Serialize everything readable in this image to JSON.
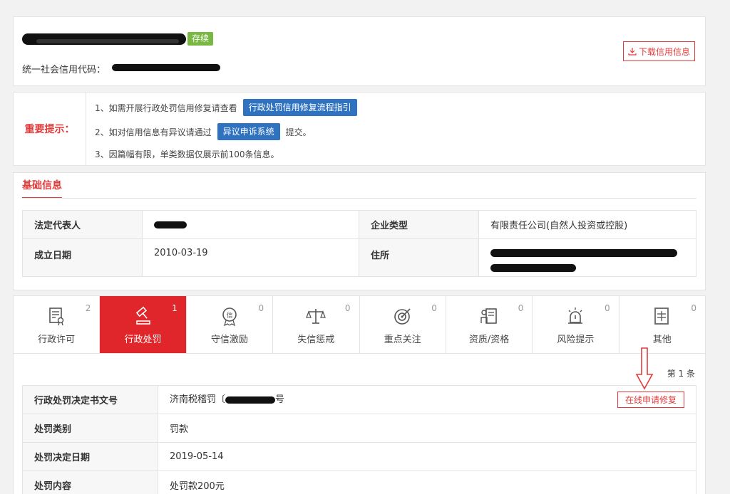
{
  "header": {
    "status_badge": "存续",
    "credit_code_label": "统一社会信用代码：",
    "download_label": "下载信用信息"
  },
  "notice": {
    "label": "重要提示：",
    "line1_text": "1、如需开展行政处罚信用修复请查看",
    "line1_button": "行政处罚信用修复流程指引",
    "line2_text": "2、如对信用信息有异议请通过",
    "line2_button": "异议申诉系统",
    "line2_suffix": "提交。",
    "line3_text": "3、因篇幅有限，单类数据仅展示前100条信息。"
  },
  "basic_info": {
    "tab_label": "基础信息",
    "legal_rep_label": "法定代表人",
    "company_type_label": "企业类型",
    "company_type_value": "有限责任公司(自然人投资或控股)",
    "established_label": "成立日期",
    "established_value": "2010-03-19",
    "address_label": "住所"
  },
  "tabs": [
    {
      "label": "行政许可",
      "count": "2",
      "icon": "license-icon"
    },
    {
      "label": "行政处罚",
      "count": "1",
      "icon": "gavel-icon"
    },
    {
      "label": "守信激励",
      "count": "0",
      "icon": "trust-medal-icon"
    },
    {
      "label": "失信惩戒",
      "count": "0",
      "icon": "scale-icon"
    },
    {
      "label": "重点关注",
      "count": "0",
      "icon": "target-icon"
    },
    {
      "label": "资质/资格",
      "count": "0",
      "icon": "certificate-icon"
    },
    {
      "label": "风险提示",
      "count": "0",
      "icon": "alarm-icon"
    },
    {
      "label": "其他",
      "count": "0",
      "icon": "other-doc-icon"
    }
  ],
  "penalty": {
    "page_count": "第 1 条",
    "rows": [
      {
        "label": "行政处罚决定书文号",
        "value_prefix": "济南税稽罚〔",
        "value_suffix": "号"
      },
      {
        "label": "处罚类别",
        "value": "罚款"
      },
      {
        "label": "处罚决定日期",
        "value": "2019-05-14"
      },
      {
        "label": "处罚内容",
        "value": "处罚款200元"
      }
    ],
    "repair_button": "在线申请修复"
  }
}
